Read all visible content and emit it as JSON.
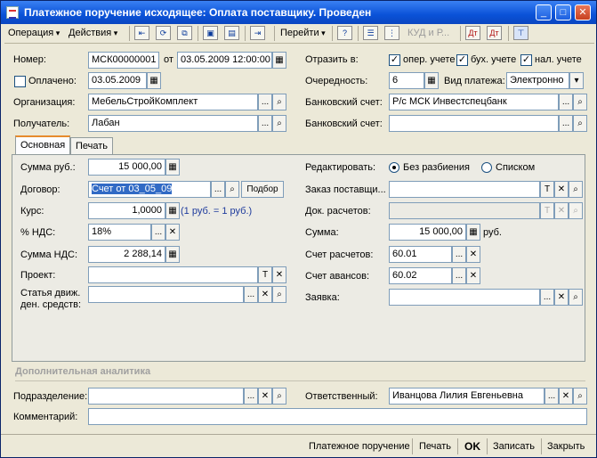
{
  "window": {
    "title": "Платежное поручение исходящее: Оплата поставщику. Проведен",
    "controls": [
      "_",
      "□",
      "✕"
    ]
  },
  "toolbar": {
    "operation": "Операция",
    "actions": "Действия",
    "goto": "Перейти",
    "kud": "КУД и Р...",
    "help_glyph": "?"
  },
  "header": {
    "number_label": "Номер:",
    "number_value": "МСК00000001",
    "from_label": "от",
    "date_value": "03.05.2009 12:00:00",
    "paid_label": "Оплачено:",
    "paid_date": "03.05.2009",
    "org_label": "Организация:",
    "org_value": "МебельСтройКомплект",
    "payee_label": "Получатель:",
    "payee_value": "Лабан",
    "reflect_label": "Отразить в:",
    "reflect_oper": "опер. учете",
    "reflect_buh": "бух. учете",
    "reflect_nal": "нал. учете",
    "order_label": "Очередность:",
    "order_value": "6",
    "pay_type_label": "Вид платежа:",
    "pay_type_value": "Электронно",
    "bank_label": "Банковский счет:",
    "bank_value": "Р/с МСК Инвестспецбанк",
    "bank2_label": "Банковский счет:",
    "bank2_value": ""
  },
  "tabs": [
    {
      "label": "Основная",
      "active": true
    },
    {
      "label": "Печать",
      "active": false
    }
  ],
  "main": {
    "sum_label": "Сумма руб.:",
    "sum_value": "15 000,00",
    "contract_label": "Договор:",
    "contract_value": "Счет от 03_05_09",
    "select_button": "Подбор",
    "rate_label": "Курс:",
    "rate_value": "1,0000",
    "rate_note": "(1 руб. = 1 руб.)",
    "vat_pct_label": "% НДС:",
    "vat_pct_value": "18%",
    "vat_sum_label": "Сумма НДС:",
    "vat_sum_value": "2 288,14",
    "project_label": "Проект:",
    "project_value": "",
    "cashflow_label_1": "Статья движ.",
    "cashflow_label_2": "ден. средств:",
    "cashflow_value": "",
    "edit_label": "Редактировать:",
    "edit_opt1": "Без разбиения",
    "edit_opt2": "Списком",
    "supplier_order_label": "Заказ поставщи...",
    "supplier_order_value": "",
    "settle_doc_label": "Док. расчетов:",
    "settle_doc_value": "",
    "amount_label": "Сумма:",
    "amount_value": "15 000,00",
    "amount_unit": "руб.",
    "settle_acc_label": "Счет расчетов:",
    "settle_acc_value": "60.01",
    "advance_acc_label": "Счет авансов:",
    "advance_acc_value": "60.02",
    "request_label": "Заявка:",
    "request_value": ""
  },
  "extra": {
    "section_title": "Дополнительная аналитика",
    "dept_label": "Подразделение:",
    "dept_value": "",
    "resp_label": "Ответственный:",
    "resp_value": "Иванцова Лилия Евгеньевна",
    "comment_label": "Комментарий:",
    "comment_value": ""
  },
  "bottom": {
    "print_form": "Платежное поручение",
    "print": "Печать",
    "ok": "OK",
    "save": "Записать",
    "close": "Закрыть"
  },
  "glyphs": {
    "ellipsis": "...",
    "clear": "✕",
    "search": "⌕",
    "text": "T",
    "calc": "▦",
    "calendar": "▦",
    "dropdown": "▾",
    "check": "✓"
  }
}
